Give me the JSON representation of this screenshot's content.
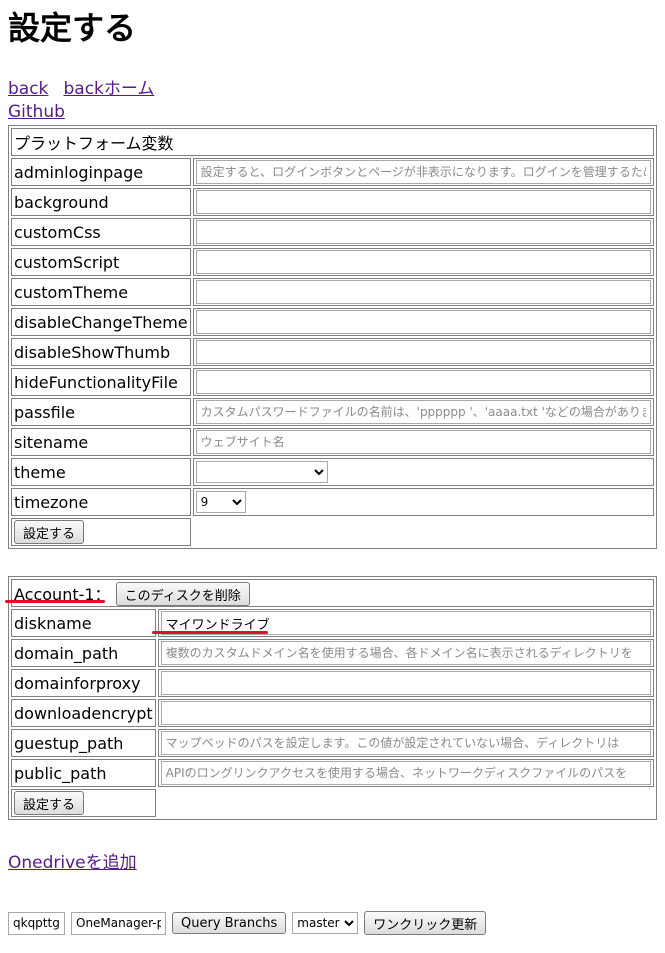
{
  "page": {
    "title": "設定する"
  },
  "nav": {
    "back": "back",
    "back_home": "backホーム",
    "github": "Github"
  },
  "platform": {
    "header": "プラットフォーム変数",
    "rows": [
      {
        "label": "adminloginpage",
        "value": "",
        "placeholder": "設定すると、ログインボタンとページが非表示になります。ログインを管理するためのURLは"
      },
      {
        "label": "background",
        "value": "",
        "placeholder": ""
      },
      {
        "label": "customCss",
        "value": "",
        "placeholder": ""
      },
      {
        "label": "customScript",
        "value": "",
        "placeholder": ""
      },
      {
        "label": "customTheme",
        "value": "",
        "placeholder": ""
      },
      {
        "label": "disableChangeTheme",
        "value": "",
        "placeholder": ""
      },
      {
        "label": "disableShowThumb",
        "value": "",
        "placeholder": ""
      },
      {
        "label": "hideFunctionalityFile",
        "value": "",
        "placeholder": ""
      },
      {
        "label": "passfile",
        "value": "",
        "placeholder": "カスタムパスワードファイルの名前は、'pppppp '、'aaaa.txt 'などの場合があります"
      },
      {
        "label": "sitename",
        "value": "",
        "placeholder": "ウェブサイト名"
      }
    ],
    "theme": {
      "label": "theme",
      "selected": ""
    },
    "timezone": {
      "label": "timezone",
      "selected": "9"
    },
    "submit": "設定する"
  },
  "account": {
    "title": "Account-1：",
    "delete_button": "このディスクを削除",
    "rows": [
      {
        "label": "diskname",
        "value": "マイワンドライブ",
        "placeholder": ""
      },
      {
        "label": "domain_path",
        "value": "",
        "placeholder": "複数のカスタムドメイン名を使用する場合、各ドメイン名に表示されるディレクトリを"
      },
      {
        "label": "domainforproxy",
        "value": "",
        "placeholder": ""
      },
      {
        "label": "downloadencrypt",
        "value": "",
        "placeholder": ""
      },
      {
        "label": "guestup_path",
        "value": "",
        "placeholder": "マップベッドのパスを設定します。この値が設定されていない場合、ディレクトリは"
      },
      {
        "label": "public_path",
        "value": "",
        "placeholder": "APIのロングリンクアクセスを使用する場合、ネットワークディスクファイルのパスを"
      }
    ],
    "submit": "設定する"
  },
  "add_onedrive": "Onedriveを追加",
  "update": {
    "owner": "qkqpttgf",
    "repo": "OneManager-php",
    "query_button": "Query Branchs",
    "branch": "master",
    "update_button": "ワンクリック更新"
  },
  "colors": {
    "link": "#551a8b",
    "annotation": "#e0102a"
  }
}
